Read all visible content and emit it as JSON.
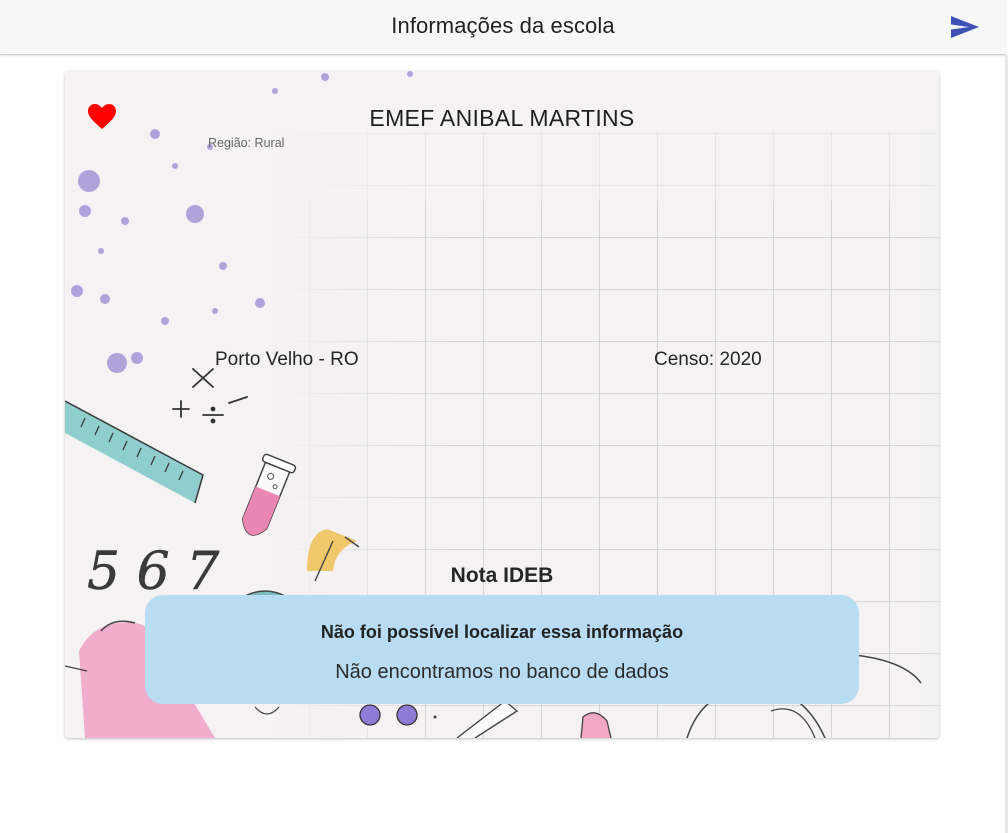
{
  "app_bar": {
    "title": "Informações da escola",
    "send_icon": "send-icon",
    "accent": "#3f51b5"
  },
  "school": {
    "name": "EMEF ANIBAL MARTINS",
    "region": "Região: Rural",
    "city": "Porto Velho - RO",
    "census": "Censo: 2020",
    "favorite_icon": "heart-icon",
    "favorite_color": "#ff0000",
    "favorited": true
  },
  "ideb": {
    "title": "Nota IDEB",
    "notice_title": "Não foi possível localizar essa informação",
    "notice_body": "Não encontramos no banco de dados",
    "notice_color": "#b8dcf2"
  },
  "illustration": {
    "handwritten_digits": "567"
  }
}
